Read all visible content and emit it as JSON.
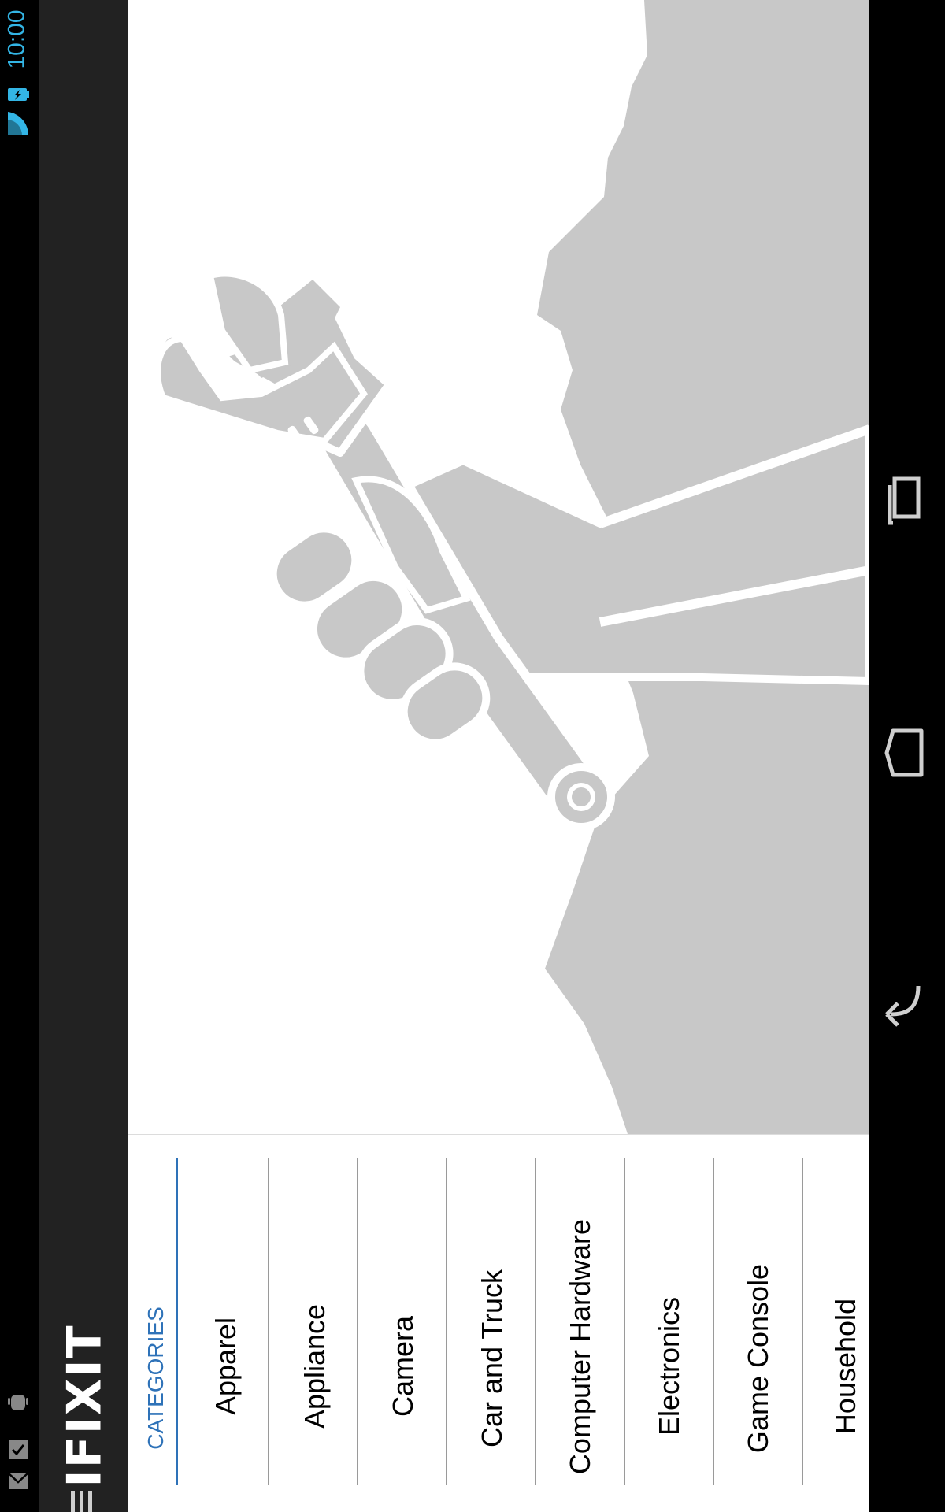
{
  "status_bar": {
    "time": "10:00",
    "icons": [
      "wifi-icon",
      "battery-charging-icon",
      "gmail-icon",
      "checkmark-icon",
      "android-icon"
    ]
  },
  "app": {
    "logo_text": "IFIXIT",
    "menu_icon": "hamburger-icon"
  },
  "hero": {
    "image": "hand-holding-wrench-illustration"
  },
  "categories": {
    "header": "CATEGORIES",
    "items": [
      {
        "label": "Apparel"
      },
      {
        "label": "Appliance"
      },
      {
        "label": "Camera"
      },
      {
        "label": "Car and Truck"
      },
      {
        "label": "Computer Hardware"
      },
      {
        "label": "Electronics"
      },
      {
        "label": "Game Console"
      },
      {
        "label": "Household"
      }
    ]
  },
  "navigation_bar": {
    "buttons": [
      "recent-apps-icon",
      "home-icon",
      "back-icon"
    ]
  },
  "colors": {
    "accent": "#2e72b8",
    "action_bar": "#222222",
    "status_accent": "#33b5e5",
    "illustration": "#c8c8c8"
  }
}
